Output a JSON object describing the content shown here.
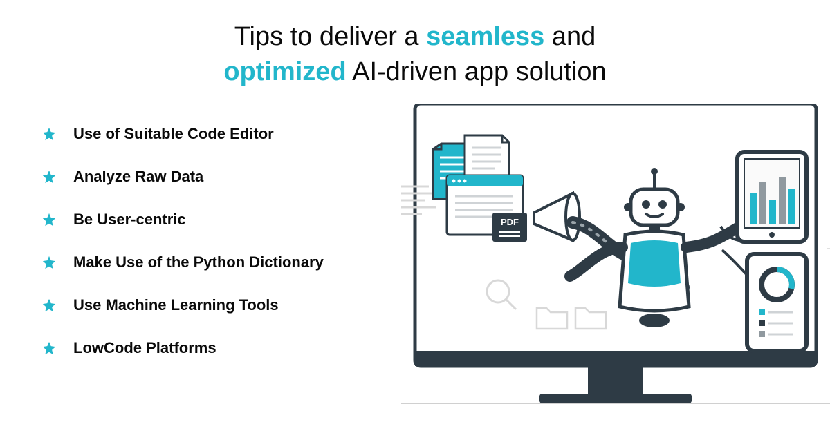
{
  "title": {
    "part1": "Tips to deliver a ",
    "accent1": "seamless",
    "part2": " and ",
    "accent2": "optimized",
    "part3": " AI-driven app solution"
  },
  "tips": [
    {
      "label": "Use of Suitable Code Editor"
    },
    {
      "label": "Analyze Raw Data"
    },
    {
      "label": "Be User-centric"
    },
    {
      "label": "Make Use of the Python Dictionary"
    },
    {
      "label": "Use Machine Learning Tools"
    },
    {
      "label": "LowCode Platforms"
    }
  ],
  "colors": {
    "accent": "#22b6cb",
    "dark": "#2e3b45",
    "light": "#e8e8e8"
  },
  "illustration": {
    "pdf_label": "PDF"
  }
}
